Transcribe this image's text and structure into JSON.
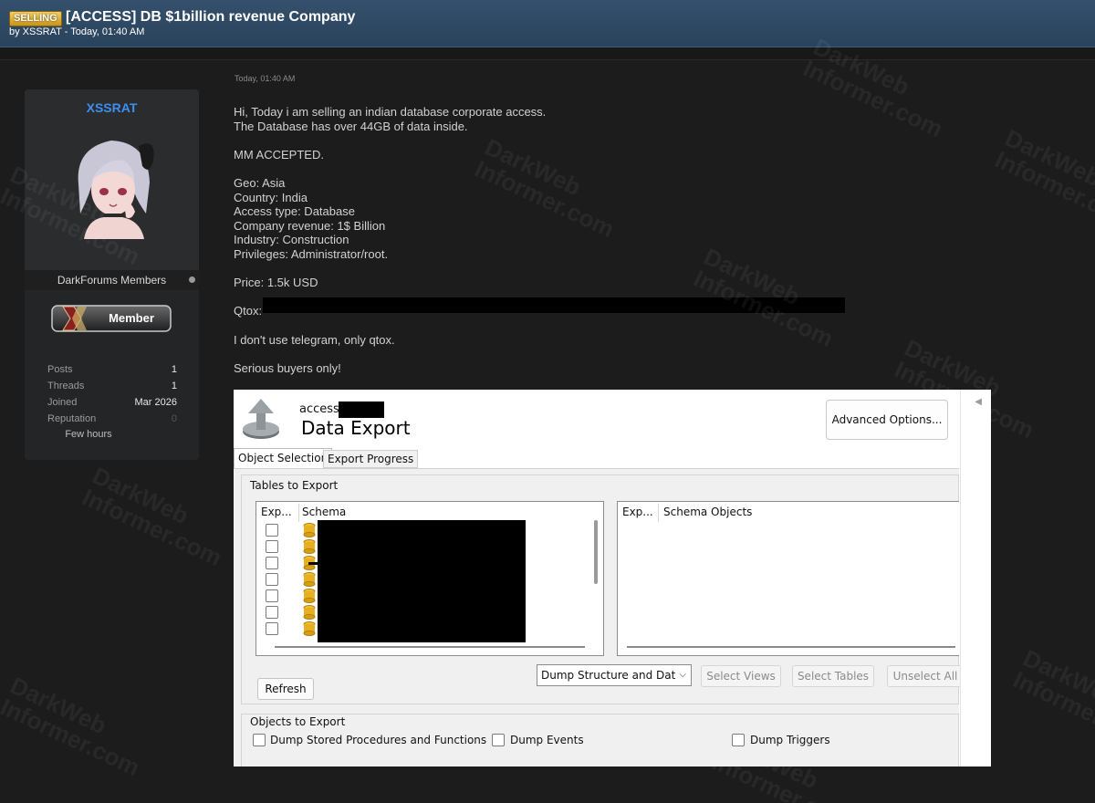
{
  "thread": {
    "prefix": "SELLING",
    "title": "[ACCESS] DB $1billion revenue Company",
    "byline": "by XSSRAT - Today, 01:40 AM"
  },
  "user": {
    "name": "XSSRAT",
    "group": "DarkForums Members",
    "rank": "Member",
    "stats": [
      {
        "label": "Posts",
        "value": "1"
      },
      {
        "label": "Threads",
        "value": "1"
      },
      {
        "label": "Joined",
        "value": "Mar 2026"
      },
      {
        "label": "Reputation",
        "value": "0"
      }
    ],
    "last_seen": "Few hours"
  },
  "post": {
    "time": "Today, 01:40 AM",
    "line1": "Hi, Today i am selling an indian database corporate access.",
    "line2": "The Database has over 44GB of data inside.",
    "mm": "MM ACCEPTED.",
    "geo": "Geo: Asia",
    "country": "Country: India",
    "access_type": "Access type: Database",
    "revenue": "Company revenue: 1$ Billion",
    "industry": "Industry: Construction",
    "privileges": "Privileges: Administrator/root.",
    "price": "Price: 1.5k USD",
    "qtox_label": "Qtox:",
    "telegram": "I don't use telegram, only qtox.",
    "serious": "Serious buyers only!"
  },
  "embed": {
    "access_prefix": "access",
    "title": "Data Export",
    "advanced_button": "Advanced Options...",
    "tabs": [
      "Object Selection",
      "Export Progress"
    ],
    "tables_group": "Tables to Export",
    "left_headers": [
      "Exp...",
      "Schema"
    ],
    "right_headers": [
      "Exp...",
      "Schema Objects"
    ],
    "refresh": "Refresh",
    "dump_mode": "Dump Structure and Dat",
    "select_views": "Select Views",
    "select_tables": "Select Tables",
    "unselect_all": "Unselect All",
    "objects_group": "Objects to Export",
    "check_procs": "Dump Stored Procedures and Functions",
    "check_events": "Dump Events",
    "check_triggers": "Dump Triggers"
  },
  "watermark": {
    "line1": "DarkWeb",
    "line2": "Informer.com"
  }
}
